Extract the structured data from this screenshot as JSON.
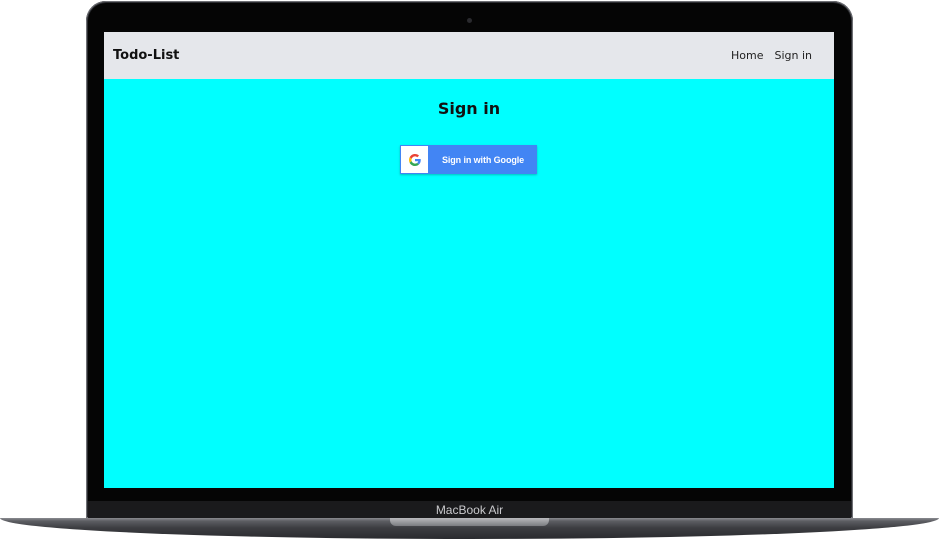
{
  "device": {
    "label": "MacBook Air"
  },
  "navbar": {
    "brand": "Todo-List",
    "links": [
      {
        "label": "Home"
      },
      {
        "label": "Sign in"
      }
    ]
  },
  "main": {
    "title": "Sign in",
    "google_button": {
      "label": "Sign in with Google",
      "icon": "google-g-icon"
    }
  },
  "colors": {
    "page_background": "#00ffff",
    "navbar_background": "#e5e7eb",
    "google_blue": "#4285f4"
  }
}
